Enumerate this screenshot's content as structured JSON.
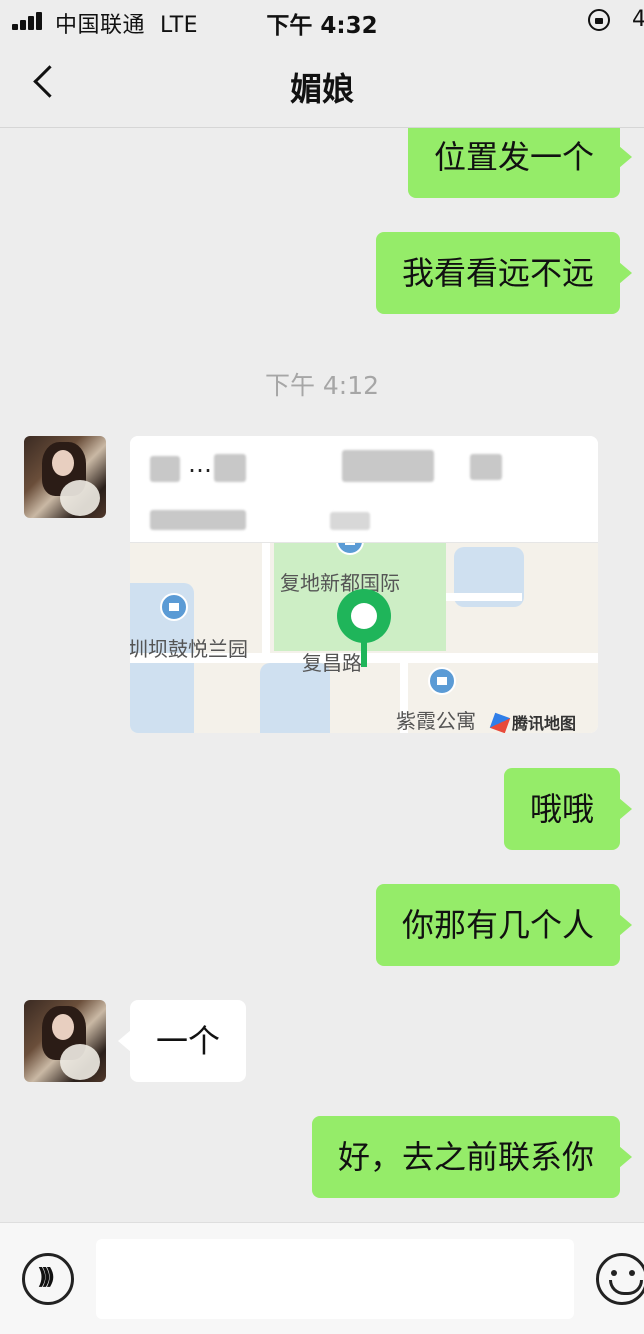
{
  "status_bar": {
    "carrier": "中国联通",
    "network": "LTE",
    "time": "下午 4:32",
    "battery_partial": "4"
  },
  "header": {
    "title": "媚娘"
  },
  "messages": [
    {
      "direction": "out",
      "text": "位置发一个"
    },
    {
      "direction": "out",
      "text": "我看看远不远"
    },
    {
      "type": "timestamp",
      "text": "下午 4:12"
    },
    {
      "direction": "in",
      "type": "location",
      "map_labels": [
        "复地新都国际",
        "复昌路",
        "紫霞公寓",
        "圳坝鼓悦兰园"
      ],
      "map_brand": "腾讯地图"
    },
    {
      "direction": "out",
      "text": "哦哦"
    },
    {
      "direction": "out",
      "text": "你那有几个人"
    },
    {
      "direction": "in",
      "text": "一个"
    },
    {
      "direction": "out",
      "text": "好，去之前联系你"
    }
  ],
  "input_bar": {
    "placeholder": ""
  },
  "icons": {
    "back": "back-icon",
    "voice": "voice-icon",
    "emoji": "emoji-icon",
    "pin": "location-pin-icon"
  },
  "colors": {
    "outgoing_bubble": "#95ec69",
    "incoming_bubble": "#ffffff",
    "background": "#ededed",
    "pin": "#1fb55a"
  }
}
